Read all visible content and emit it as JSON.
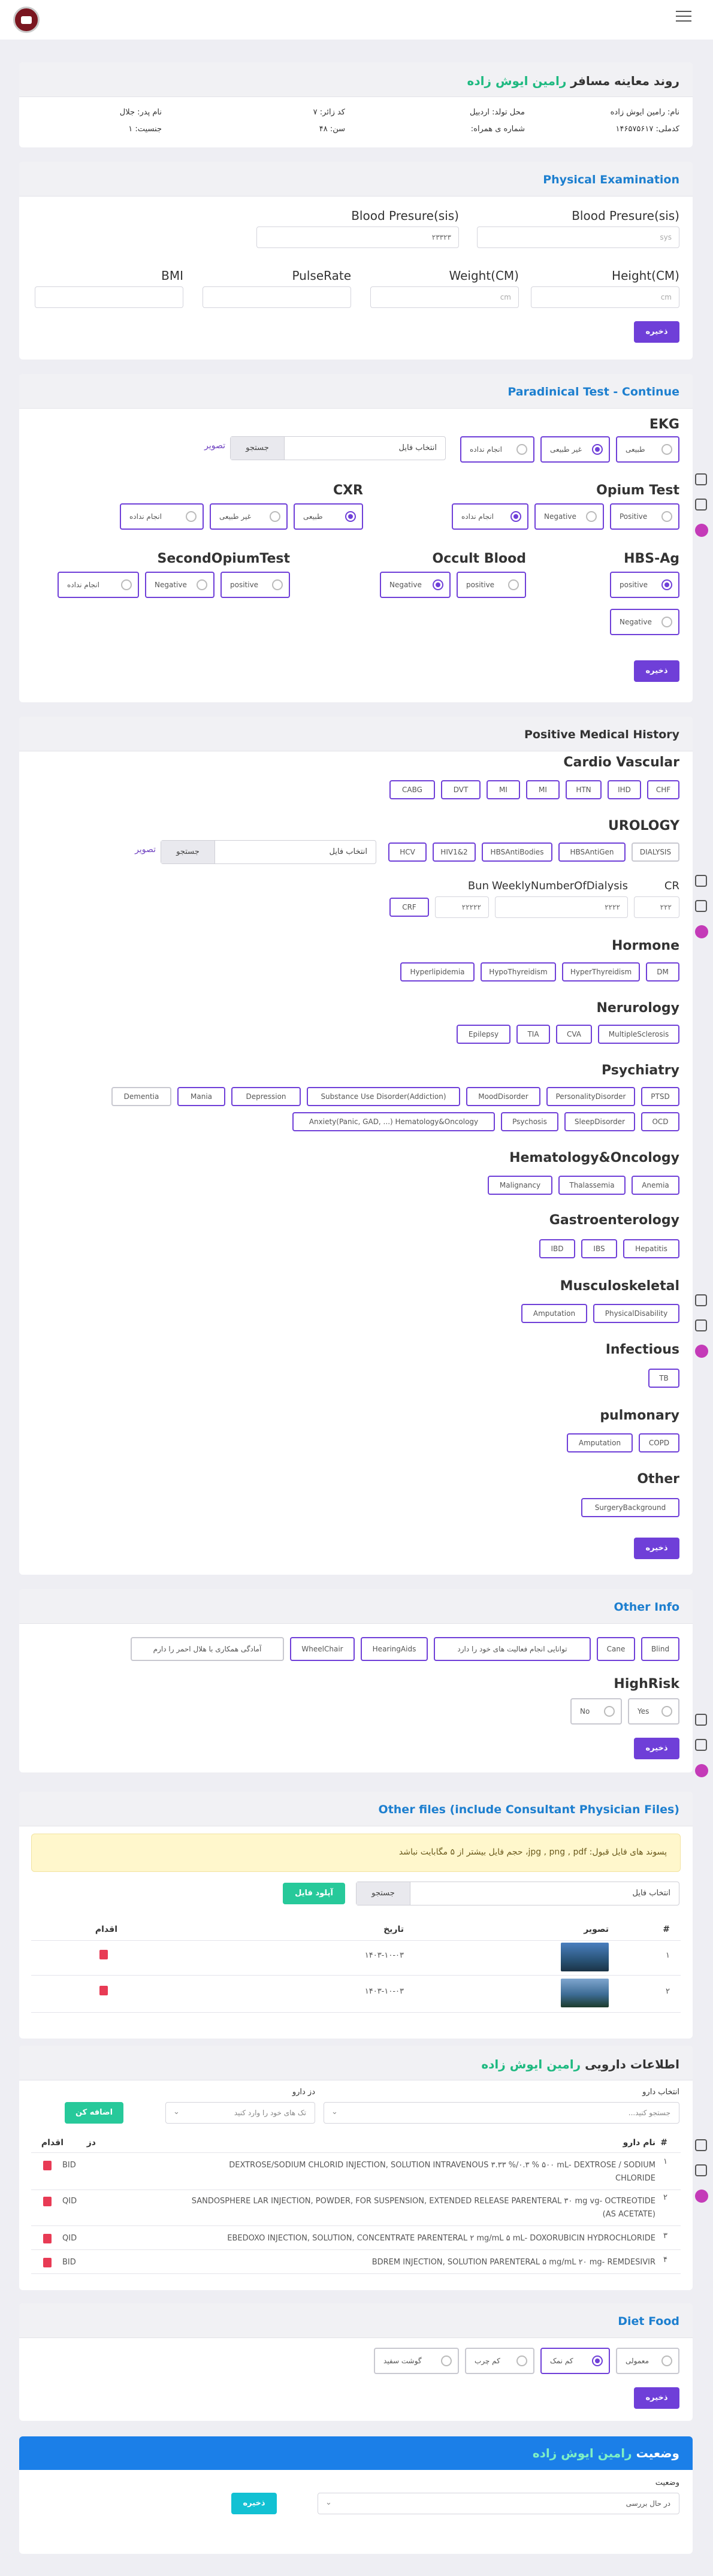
{
  "colors": {
    "accent": "#6f3fd8",
    "green": "#1eb980",
    "blue": "#1d7fcf",
    "orange": "#f39c12",
    "red": "#e83b55",
    "cyan": "#12c1d3",
    "header_blue": "#1b7fe8"
  },
  "patient": {
    "title_prefix": "روند معاینه مسافر",
    "name": "رامین ایوش زاده",
    "name_line": "نام: رامین ایوش زاده",
    "birthplace": "محل تولد: اردبیل",
    "zone_code": "کد زائر: ۷",
    "father": "نام پدر: جلال",
    "national_code": "کدملی: ۱۴۶۵۷۵۶۱۷",
    "phone": "شماره ی همراه:",
    "age": "سن: ۴۸",
    "gender": "جنسیت: ۱"
  },
  "physical": {
    "title": "Physical Examination",
    "bp1_label": "Blood Presure(sis)",
    "bp1_placeholder": "sys",
    "bp2_label": "Blood Presure(sis)",
    "bp2_value": "۲۳۳۲۳",
    "height_label": "Height(CM)",
    "height_placeholder": "cm",
    "weight_label": "Weight(CM)",
    "weight_placeholder": "cm",
    "pulse_label": "PulseRate",
    "bmi_label": "BMI",
    "save": "ذخیره"
  },
  "paraclinical": {
    "title": "Paradinical Test - Continue",
    "ekg": "EKG",
    "ekg_opts": [
      "طبیعی",
      "غیر طبیعی",
      "انجام نداده"
    ],
    "file_label": "انتخاب فایل",
    "browse": "جستجو",
    "image": "تصویر",
    "opium": "Opium Test",
    "opium_opts": [
      "Positive",
      "Negative",
      "انجام نداده"
    ],
    "cxr": "CXR",
    "cxr_opts": [
      "طبیعی",
      "غیر طبیعی",
      "انجام نداده"
    ],
    "hbs": "HBS-Ag",
    "hbs_opts": [
      "positive",
      "Negative"
    ],
    "occult": "Occult Blood",
    "occult_opts": [
      "positive",
      "Negative"
    ],
    "second": "SecondOpiumTest",
    "second_opts": [
      "positive",
      "Negative",
      "انجام نداده"
    ],
    "save": "ذخیره"
  },
  "history": {
    "title": "Positive Medical History",
    "cardio": "Cardio Vascular",
    "cardio_tags": [
      "CHF",
      "IHD",
      "HTN",
      "MI",
      "MI",
      "DVT",
      "CABG"
    ],
    "urology": "UROLOGY",
    "urology_tags": [
      "DIALYSIS",
      "HBSAntiGen",
      "HBSAntiBodies",
      "HIV1&2",
      "HCV"
    ],
    "file_label": "انتخاب فایل",
    "browse": "جستجو",
    "image": "تصویر",
    "cr": "CR",
    "cr_val": "۲۲۲",
    "wnd": "WeeklyNumberOfDialysis",
    "wnd_val": "۲۲۲۲",
    "bun": "Bun",
    "bun_val": "۲۲۲۲۲",
    "crf": "CRF",
    "hormone": "Hormone",
    "hormone_tags": [
      "DM",
      "HyperThyreidism",
      "HypoThyreidism",
      "Hyperlipidemia"
    ],
    "neuro": "Nerurology",
    "neuro_tags": [
      "MultipleSclerosis",
      "CVA",
      "TIA",
      "Epilepsy"
    ],
    "psych": "Psychiatry",
    "psych_tags1": [
      "PTSD",
      "PersonalityDisorder",
      "MoodDisorder",
      "Substance Use Disorder(Addiction)",
      "Depression",
      "Mania",
      "Dementia"
    ],
    "psych_tags2": [
      "OCD",
      "SleepDisorder",
      "Psychosis",
      "Anxiety(Panic, GAD, ...) Hematology&Oncology"
    ],
    "hemo": "Hematology&Oncology",
    "hemo_tags": [
      "Anemia",
      "Thalassemia",
      "Malignancy"
    ],
    "gastro": "Gastroenterology",
    "gastro_tags": [
      "Hepatitis",
      "IBS",
      "IBD"
    ],
    "musculo": "Musculoskeletal",
    "musculo_tags": [
      "PhysicalDisability",
      "Amputation"
    ],
    "infectious": "Infectious",
    "infectious_tags": [
      "TB"
    ],
    "pulmonary": "pulmonary",
    "pulmonary_tags": [
      "COPD",
      "Amputation"
    ],
    "other": "Other",
    "other_tags": [
      "SurgeryBackground"
    ],
    "save": "ذخیره"
  },
  "other_info": {
    "title": "Other Info",
    "tags": [
      "Blind",
      "Cane",
      "توانایی انجام فعالیت های خود را دارد",
      "HearingAids",
      "WheelChair",
      "آمادگی همکاری با هلال احمر را دارم"
    ],
    "highrisk": "HighRisk",
    "highrisk_opts": [
      "Yes",
      "No"
    ],
    "save": "ذخیره"
  },
  "files": {
    "title": "Other files (include Consultant Physician Files)",
    "notice": "پسوند های فایل قبول: jpg , png , pdf، حجم فایل بیشتر از ۵ مگابایت نباشد",
    "file_label": "انتخاب فایل",
    "browse": "جستجو",
    "upload": "آپلود فایل",
    "col_num": "#",
    "col_image": "تصویر",
    "col_date": "تاریخ",
    "col_action": "اقدام",
    "rows": [
      {
        "num": "۱",
        "date": "۱۴۰۳-۱۰-۰۳"
      },
      {
        "num": "۲",
        "date": "۱۴۰۳-۱۰-۰۳"
      }
    ]
  },
  "drugs": {
    "title_prefix": "اطلاعات دارویی",
    "name": "رامین ایوش زاده",
    "select_label": "انتخاب دارو",
    "select_value": "جستجو کنید...",
    "dose_label": "دز دارو",
    "dose_value": "تک های خود را وارد کنید",
    "add": "اضافه کن",
    "col_num": "#",
    "col_name": "نام دارو",
    "col_dose": "دز",
    "col_action": "اقدام",
    "rows": [
      {
        "num": "۱",
        "name": "DEXTROSE/SODIUM CHLORID INJECTION, SOLUTION INTRAVENOUS ۳.۳۳ %/۰.۳ % ۵۰۰ mL- DEXTROSE / SODIUM",
        "name2": "CHLORIDE",
        "dose": "BID"
      },
      {
        "num": "۲",
        "name": "SANDOSPHERE LAR INJECTION, POWDER, FOR SUSPENSION, EXTENDED RELEASE PARENTERAL ۳۰ mg vg- OCTREOTIDE",
        "name2": "(AS ACETATE)",
        "dose": "QID"
      },
      {
        "num": "۳",
        "name": "EBEDOXO INJECTION, SOLUTION, CONCENTRATE PARENTERAL ۲ mg/mL ۵ mL- DOXORUBICIN HYDROCHLORIDE",
        "name2": "",
        "dose": "QID"
      },
      {
        "num": "۴",
        "name": "BDREM INJECTION, SOLUTION PARENTERAL ۵ mg/mL ۲۰ mg- REMDESIVIR",
        "name2": "",
        "dose": "BID"
      }
    ]
  },
  "diet": {
    "title": "Diet Food",
    "opts": [
      "معمولی",
      "کم نمک",
      "کم چرب",
      "گوشت سفید"
    ],
    "save": "ذخیره"
  },
  "status": {
    "title_prefix": "وضعیت",
    "name": "رامین ایوش زاده",
    "label": "وضعیت",
    "value": "در حال بررسی",
    "save": "ذخیره"
  }
}
